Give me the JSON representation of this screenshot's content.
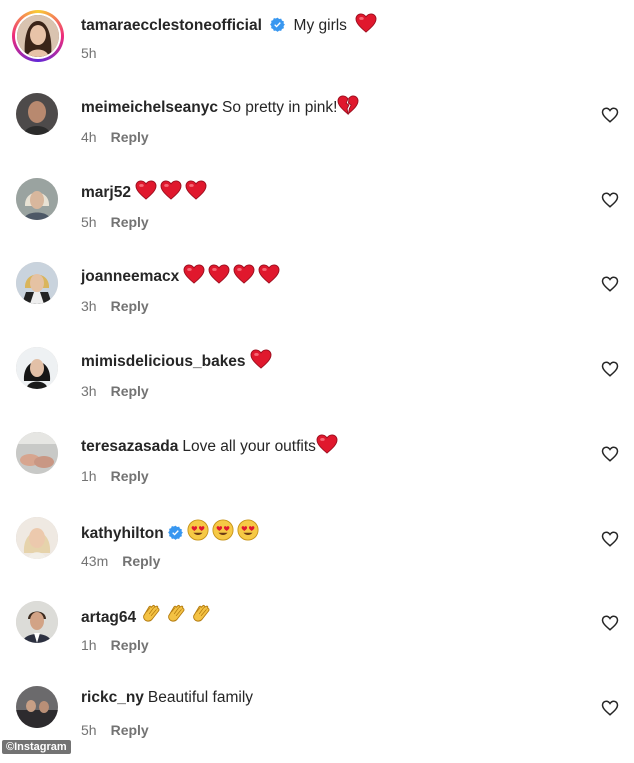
{
  "caption": {
    "username": "tamaraecclestoneofficial",
    "verified": true,
    "text": "My girls",
    "time": "5h",
    "emoji": "red-heart"
  },
  "reply_label": "Reply",
  "comments": [
    {
      "username": "meimeichelseanyc",
      "text": "So pretty in pink!",
      "emoji": "broken-heart",
      "emoji_count": 1,
      "time": "4h",
      "verified": false
    },
    {
      "username": "marj52",
      "text": "",
      "emoji": "red-heart",
      "emoji_count": 3,
      "time": "5h",
      "verified": false
    },
    {
      "username": "joanneemacx",
      "text": "",
      "emoji": "red-heart",
      "emoji_count": 4,
      "time": "3h",
      "verified": false
    },
    {
      "username": "mimisdelicious_bakes",
      "text": "",
      "emoji": "red-heart",
      "emoji_count": 1,
      "time": "3h",
      "verified": false
    },
    {
      "username": "teresazasada",
      "text": "Love all your outfits",
      "emoji": "red-heart",
      "emoji_count": 1,
      "time": "1h",
      "verified": false
    },
    {
      "username": "kathyhilton",
      "text": "",
      "emoji": "heart-eyes",
      "emoji_count": 3,
      "time": "43m",
      "verified": true
    },
    {
      "username": "artag64",
      "text": "",
      "emoji": "clapping-hands",
      "emoji_count": 3,
      "time": "1h",
      "verified": false
    },
    {
      "username": "rickc_ny",
      "text": "Beautiful family",
      "emoji": "",
      "emoji_count": 0,
      "time": "5h",
      "verified": false
    }
  ],
  "watermark": "©Instagram",
  "colors": {
    "verified": "#3897f0",
    "heart": "#e0182d",
    "muted": "#737373"
  }
}
